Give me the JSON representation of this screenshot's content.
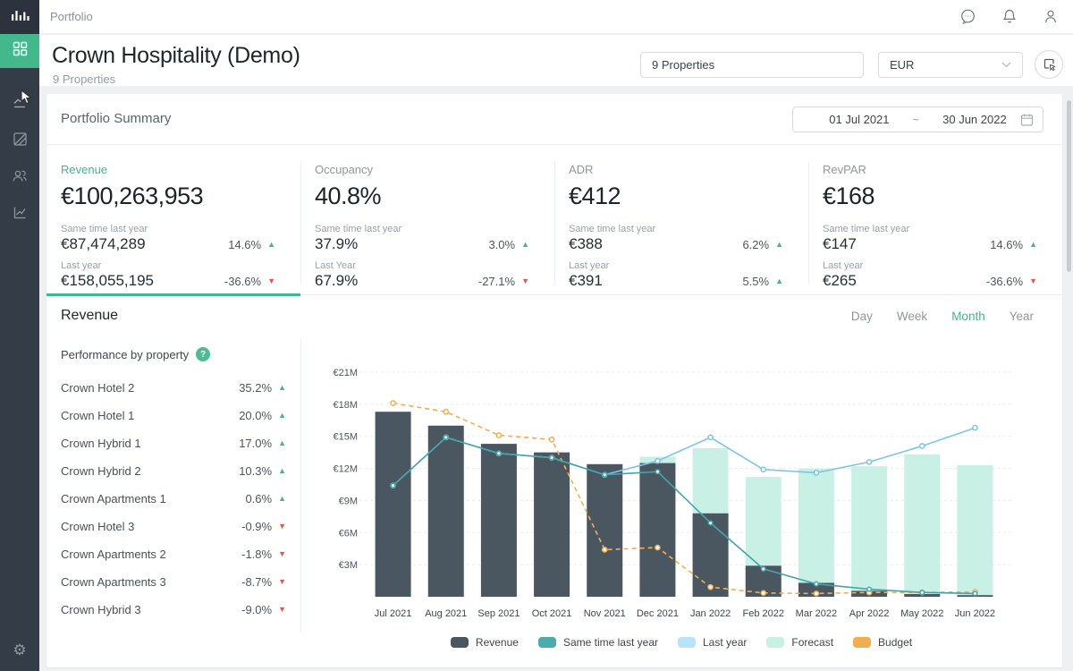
{
  "topbar": {
    "title": "Portfolio",
    "icons": [
      "chat",
      "notifications",
      "account"
    ]
  },
  "sidebar": {
    "logo": "equalizer-bars-logo",
    "items": [
      "dashboard-grid",
      "trends",
      "blocked",
      "users",
      "analytics"
    ],
    "bottom": "settings-gear"
  },
  "header": {
    "title": "Crown Hospitality (Demo)",
    "subtitle": "9 Properties",
    "properties_selector": "9 Properties",
    "currency": "EUR"
  },
  "summary": {
    "title": "Portfolio Summary",
    "date_from": "01 Jul 2021",
    "date_sep": "~",
    "date_to": "30 Jun 2022",
    "kpis": [
      {
        "label": "Revenue",
        "value": "€100,263,953",
        "active": true,
        "rows": [
          {
            "label": "Same time last year",
            "value": "€87,474,289",
            "change": "14.6%",
            "dir": "up"
          },
          {
            "label": "Last year",
            "value": "€158,055,195",
            "change": "-36.6%",
            "dir": "down"
          }
        ]
      },
      {
        "label": "Occupancy",
        "value": "40.8%",
        "active": false,
        "rows": [
          {
            "label": "Same time last year",
            "value": "37.9%",
            "change": "3.0%",
            "dir": "up"
          },
          {
            "label": "Last Year",
            "value": "67.9%",
            "change": "-27.1%",
            "dir": "down"
          }
        ]
      },
      {
        "label": "ADR",
        "value": "€412",
        "active": false,
        "rows": [
          {
            "label": "Same time last year",
            "value": "€388",
            "change": "6.2%",
            "dir": "up"
          },
          {
            "label": "Last year",
            "value": "€391",
            "change": "5.5%",
            "dir": "up"
          }
        ]
      },
      {
        "label": "RevPAR",
        "value": "€168",
        "active": false,
        "rows": [
          {
            "label": "Same time last year",
            "value": "€147",
            "change": "14.6%",
            "dir": "up"
          },
          {
            "label": "Last year",
            "value": "€265",
            "change": "-36.6%",
            "dir": "down"
          }
        ]
      }
    ]
  },
  "revenue_section": {
    "title": "Revenue",
    "tabs": [
      {
        "label": "Day",
        "active": false
      },
      {
        "label": "Week",
        "active": false
      },
      {
        "label": "Month",
        "active": true
      },
      {
        "label": "Year",
        "active": false
      }
    ],
    "performance": {
      "title": "Performance by property",
      "items": [
        {
          "name": "Crown Hotel 2",
          "change": "35.2%",
          "dir": "up"
        },
        {
          "name": "Crown Hotel 1",
          "change": "20.0%",
          "dir": "up"
        },
        {
          "name": "Crown Hybrid 1",
          "change": "17.0%",
          "dir": "up"
        },
        {
          "name": "Crown Hybrid 2",
          "change": "10.3%",
          "dir": "up"
        },
        {
          "name": "Crown Apartments 1",
          "change": "0.6%",
          "dir": "up"
        },
        {
          "name": "Crown Hotel 3",
          "change": "-0.9%",
          "dir": "down"
        },
        {
          "name": "Crown Apartments 2",
          "change": "-1.8%",
          "dir": "down"
        },
        {
          "name": "Crown Apartments 3",
          "change": "-8.7%",
          "dir": "down"
        },
        {
          "name": "Crown Hybrid 3",
          "change": "-9.0%",
          "dir": "down"
        }
      ]
    }
  },
  "chart_data": {
    "type": "combo",
    "title": "Revenue by month",
    "categories": [
      "Jul 2021",
      "Aug 2021",
      "Sep 2021",
      "Oct 2021",
      "Nov 2021",
      "Dec 2021",
      "Jan 2022",
      "Feb 2022",
      "Mar 2022",
      "Apr 2022",
      "May 2022",
      "Jun 2022"
    ],
    "unit": "€M",
    "ylim": [
      0,
      21
    ],
    "yticks": [
      3,
      6,
      9,
      12,
      15,
      18,
      21
    ],
    "ytick_labels": [
      "€3M",
      "€6M",
      "€9M",
      "€12M",
      "€15M",
      "€18M",
      "€21M"
    ],
    "grid": "dashed-horizontal",
    "legend_position": "bottom",
    "series": [
      {
        "name": "Forecast",
        "type": "bar",
        "color": "#c9f0e4",
        "values": [
          null,
          null,
          null,
          null,
          null,
          13.1,
          13.9,
          11.2,
          12.0,
          12.2,
          13.3,
          12.3
        ]
      },
      {
        "name": "Revenue",
        "type": "bar",
        "color": "#4a5760",
        "values": [
          17.3,
          16.0,
          14.3,
          13.5,
          12.4,
          12.5,
          7.8,
          2.9,
          1.3,
          0.55,
          0.25,
          0.15
        ]
      },
      {
        "name": "Budget",
        "type": "line-dashed",
        "color": "#f2ae4e",
        "values": [
          18.1,
          17.3,
          15.1,
          14.7,
          4.4,
          4.6,
          0.9,
          0.35,
          0.3,
          0.4,
          0.4,
          0.45
        ]
      },
      {
        "name": "Last year",
        "type": "line",
        "color": "#7cc4ea",
        "swatch": "#b9e3f9",
        "values": [
          10.4,
          14.9,
          13.4,
          13.0,
          11.4,
          12.7,
          14.9,
          11.9,
          11.6,
          12.6,
          14.1,
          15.8
        ]
      },
      {
        "name": "Same time last year",
        "type": "line",
        "color": "#42a5ac",
        "swatch": "#4aacab",
        "values": [
          10.4,
          14.9,
          13.4,
          13.0,
          11.4,
          11.7,
          6.9,
          2.6,
          1.2,
          0.7,
          0.4,
          0.3
        ]
      }
    ],
    "legend_order": [
      "Revenue",
      "Same time last year",
      "Last year",
      "Forecast",
      "Budget"
    ]
  }
}
